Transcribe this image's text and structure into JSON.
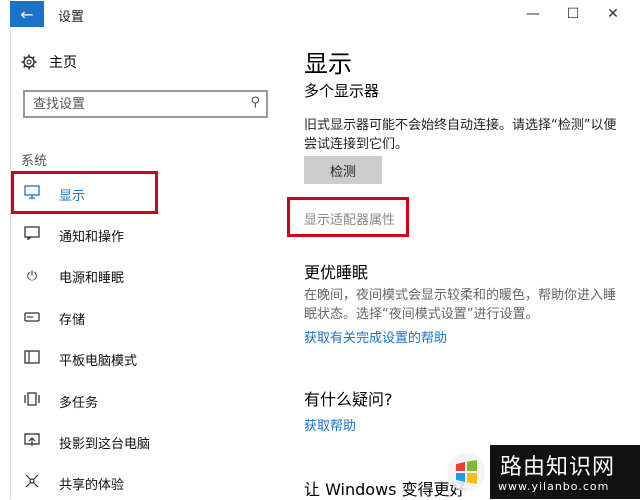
{
  "window": {
    "title": "设置",
    "back_icon": "←",
    "minimize": "—",
    "maximize": "☐",
    "close": "✕"
  },
  "sidebar": {
    "home_label": "主页",
    "search_placeholder": "查找设置",
    "section_label": "系统",
    "items": [
      {
        "label": "显示",
        "icon": "monitor-icon"
      },
      {
        "label": "通知和操作",
        "icon": "notification-icon"
      },
      {
        "label": "电源和睡眠",
        "icon": "power-icon"
      },
      {
        "label": "存储",
        "icon": "storage-icon"
      },
      {
        "label": "平板电脑模式",
        "icon": "tablet-icon"
      },
      {
        "label": "多任务",
        "icon": "multitask-icon"
      },
      {
        "label": "投影到这台电脑",
        "icon": "project-icon"
      },
      {
        "label": "共享的体验",
        "icon": "share-icon"
      }
    ]
  },
  "main": {
    "title": "显示",
    "multi_display_heading": "多个显示器",
    "multi_display_desc": "旧式显示器可能不会始终自动连接。请选择“检测”以便尝试连接到它们。",
    "detect_button": "检测",
    "adapter_link": "显示适配器属性",
    "sleep_heading": "更优睡眠",
    "sleep_desc": "在晚间，夜间模式会显示较柔和的暖色，帮助你进入睡眠状态。选择“夜间模式设置”进行设置。",
    "sleep_link": "获取有关完成设置的帮助",
    "question_heading": "有什么疑问?",
    "help_link": "获取帮助",
    "windows_heading": "让 Windows 变得更好"
  },
  "watermark": {
    "title": "路由知识网",
    "url": "www.yilanbo.com"
  }
}
